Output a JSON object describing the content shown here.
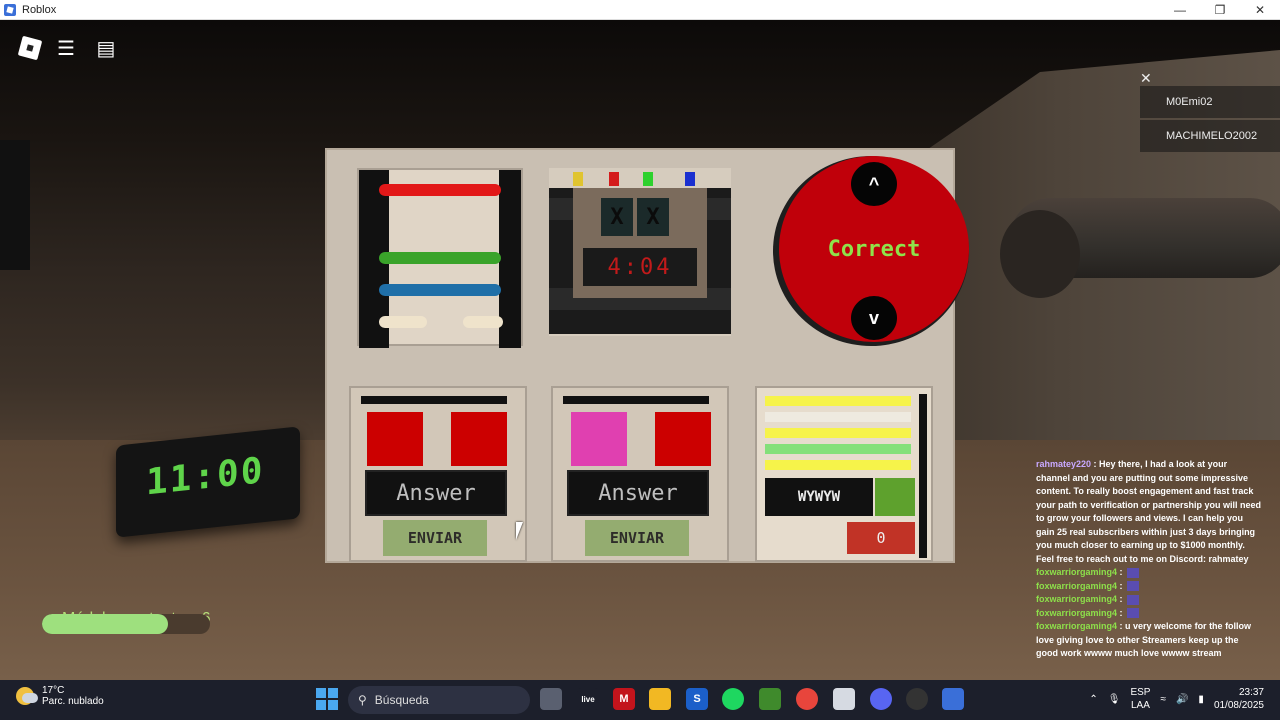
{
  "window": {
    "title": "Roblox",
    "min": "—",
    "max": "❐",
    "close": "✕"
  },
  "hud": {
    "menu_icon": "☰",
    "chat_icon": "▤"
  },
  "players": {
    "close": "✕",
    "list": [
      "M0Emi02",
      "MACHIMELO2002"
    ]
  },
  "desk_clock": {
    "time": "11:00"
  },
  "bomb": {
    "module_xs": [
      "X",
      "X"
    ],
    "timer": "4:04",
    "dial": {
      "label": "Correct",
      "up": "^",
      "down": "v"
    },
    "answer_modules": [
      {
        "answer_label": "Answer",
        "send_label": "ENVIAR",
        "colors": [
          "#cc0000",
          "#cc0000"
        ]
      },
      {
        "answer_label": "Answer",
        "send_label": "ENVIAR",
        "colors": [
          "#e040b0",
          "#cc0000"
        ]
      }
    ],
    "code_module": {
      "code": "WYWYW",
      "counter": "0",
      "lines": [
        "#f6f34a",
        "#eeeae0",
        "#f6f34a",
        "#84e07a",
        "#f6f34a"
      ]
    }
  },
  "chat": {
    "messages": [
      {
        "name": "rahmatey220",
        "sep": " : ",
        "text": "Hey there, I had a look at your channel and you are putting out some impressive content. To really boost engagement and fast track your path to verification or partnership you will need to grow your followers and views. I can help you gain 25 real subscribers within just 3 days bringing you much closer to earning up to $1000 monthly. Feel free to reach out to me on Discord: rahmatey"
      },
      {
        "name": "foxwarriorgaming4",
        "sep": " : ",
        "text": ""
      },
      {
        "name": "foxwarriorgaming4",
        "sep": " : ",
        "text": ""
      },
      {
        "name": "foxwarriorgaming4",
        "sep": " : ",
        "text": ""
      },
      {
        "name": "foxwarriorgaming4",
        "sep": " : ",
        "text": ""
      },
      {
        "name": "foxwarriorgaming4",
        "sep": " : ",
        "text": "u very welcome for the follow love giving love to other Streamers keep up the good work wwww much love wwww stream"
      }
    ]
  },
  "modules_remaining": {
    "label": "Módulos restantes: 6",
    "progress_fraction": 0.75
  },
  "taskbar": {
    "weather": {
      "temp": "17°C",
      "desc": "Parc. nublado"
    },
    "search_placeholder": "Búsqueda",
    "apps": [
      "file-explorer-icon",
      "live-icon",
      "mcafee-icon",
      "folder-icon",
      "skype-icon",
      "spotify-icon",
      "minecraft-icon",
      "chrome-icon",
      "notes-icon",
      "discord-icon",
      "obs-icon",
      "roblox-icon"
    ],
    "lang": {
      "line1": "ESP",
      "line2": "LAA"
    },
    "time": "23:37",
    "date": "01/08/2025"
  }
}
